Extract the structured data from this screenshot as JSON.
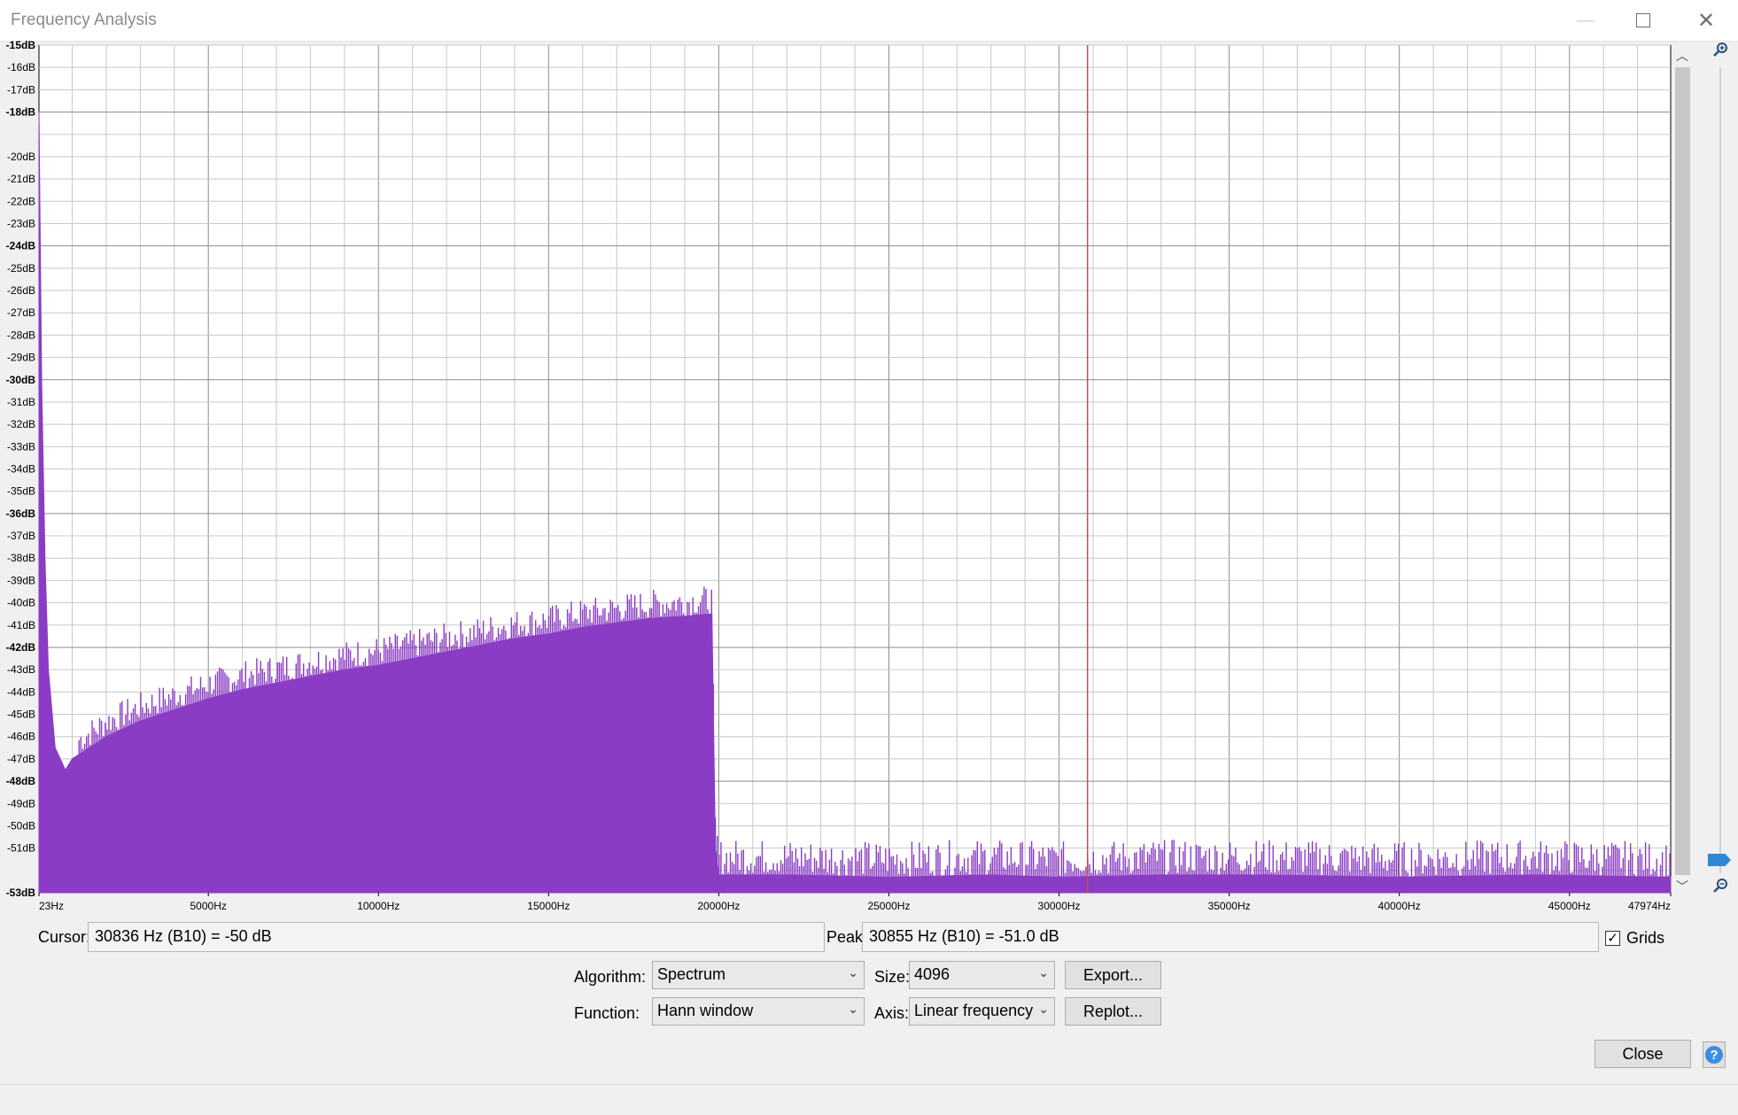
{
  "window": {
    "title": "Frequency Analysis",
    "minimize_glyph": "—",
    "close_glyph": "✕"
  },
  "chart_data": {
    "type": "area",
    "title": "",
    "xlabel": "",
    "ylabel": "",
    "x_range_hz": [
      23,
      47974
    ],
    "y_range_db": [
      -53,
      -15
    ],
    "x_ticks": [
      "23Hz",
      "5000Hz",
      "10000Hz",
      "15000Hz",
      "20000Hz",
      "25000Hz",
      "30000Hz",
      "35000Hz",
      "40000Hz",
      "45000Hz",
      "47974Hz"
    ],
    "x_tick_values": [
      23,
      5000,
      10000,
      15000,
      20000,
      25000,
      30000,
      35000,
      40000,
      45000,
      47974
    ],
    "y_ticks": [
      "-15dB",
      "-16dB",
      "-17dB",
      "-18dB",
      "-20dB",
      "-21dB",
      "-22dB",
      "-23dB",
      "-24dB",
      "-25dB",
      "-26dB",
      "-27dB",
      "-28dB",
      "-29dB",
      "-30dB",
      "-31dB",
      "-32dB",
      "-33dB",
      "-34dB",
      "-35dB",
      "-36dB",
      "-37dB",
      "-38dB",
      "-39dB",
      "-40dB",
      "-41dB",
      "-42dB",
      "-43dB",
      "-44dB",
      "-45dB",
      "-46dB",
      "-47dB",
      "-48dB",
      "-49dB",
      "-50dB",
      "-51dB",
      "-53dB"
    ],
    "y_tick_values": [
      -15,
      -16,
      -17,
      -18,
      -20,
      -21,
      -22,
      -23,
      -24,
      -25,
      -26,
      -27,
      -28,
      -29,
      -30,
      -31,
      -32,
      -33,
      -34,
      -35,
      -36,
      -37,
      -38,
      -39,
      -40,
      -41,
      -42,
      -43,
      -44,
      -45,
      -46,
      -47,
      -48,
      -49,
      -50,
      -51,
      -53
    ],
    "bold_ticks": [
      "-15dB",
      "-18dB",
      "-24dB",
      "-30dB",
      "-36dB",
      "-42dB",
      "-48dB",
      "-53dB"
    ],
    "grid": true,
    "series": [
      {
        "color": "#8a3cc4",
        "points": [
          [
            23,
            -18
          ],
          [
            100,
            -30
          ],
          [
            200,
            -38
          ],
          [
            300,
            -43
          ],
          [
            500,
            -46.5
          ],
          [
            800,
            -47.5
          ],
          [
            1000,
            -47
          ],
          [
            1500,
            -46.5
          ],
          [
            2000,
            -46
          ],
          [
            3000,
            -45.3
          ],
          [
            4000,
            -44.8
          ],
          [
            5000,
            -44.3
          ],
          [
            6000,
            -43.9
          ],
          [
            7000,
            -43.6
          ],
          [
            8000,
            -43.3
          ],
          [
            9000,
            -43
          ],
          [
            10000,
            -42.8
          ],
          [
            11000,
            -42.5
          ],
          [
            12000,
            -42.2
          ],
          [
            13000,
            -41.9
          ],
          [
            14000,
            -41.6
          ],
          [
            15000,
            -41.4
          ],
          [
            16000,
            -41.1
          ],
          [
            17000,
            -40.9
          ],
          [
            18000,
            -40.7
          ],
          [
            19000,
            -40.6
          ],
          [
            19800,
            -40.5
          ],
          [
            19900,
            -51
          ],
          [
            20000,
            -52.2
          ],
          [
            22000,
            -52.2
          ],
          [
            25000,
            -52.3
          ],
          [
            28000,
            -52.2
          ],
          [
            30000,
            -52.3
          ],
          [
            33000,
            -52.2
          ],
          [
            36000,
            -52.2
          ],
          [
            40000,
            -52.3
          ],
          [
            44000,
            -52.2
          ],
          [
            47974,
            -52.3
          ]
        ]
      }
    ],
    "cursor_line_hz": 30836,
    "cursor_color": "#c0504d"
  },
  "status": {
    "cursor_label": "Cursor:",
    "cursor_value": "30836 Hz (B10) = -50 dB",
    "peak_label": "Peak:",
    "peak_value": "30855 Hz (B10) = -51.0 dB",
    "grids_label": "Grids",
    "grids_checked": true,
    "check_glyph": "✓"
  },
  "controls": {
    "algorithm_label": "Algorithm:",
    "algorithm_value": "Spectrum",
    "size_label": "Size:",
    "size_value": "4096",
    "function_label": "Function:",
    "function_value": "Hann window",
    "axis_label": "Axis:",
    "axis_value": "Linear frequency",
    "export_label": "Export...",
    "replot_label": "Replot...",
    "close_label": "Close",
    "help_glyph": "?"
  },
  "scroll": {
    "up_glyph": "︿",
    "down_glyph": "﹀",
    "zoom_in_icon": "zoom-in-icon",
    "zoom_out_icon": "zoom-out-icon"
  }
}
